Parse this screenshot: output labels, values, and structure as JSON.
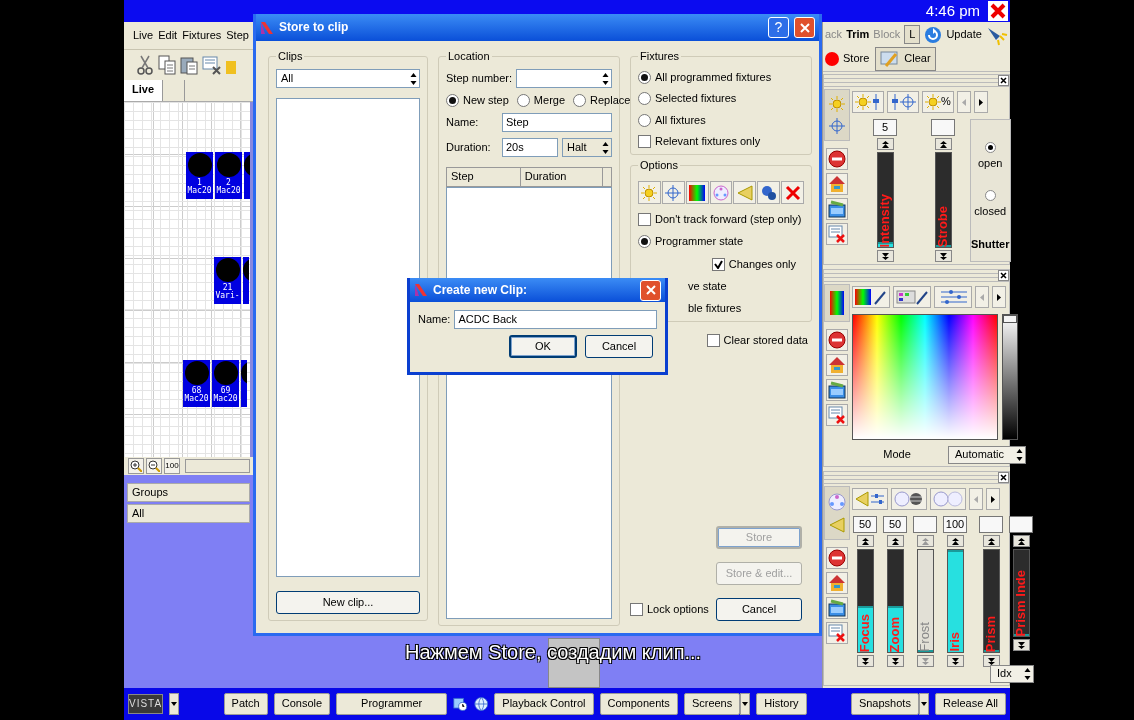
{
  "window": {
    "clock": "4:46 pm"
  },
  "menu": [
    "Live",
    "Edit",
    "Fixtures",
    "Step"
  ],
  "view_tabs": [
    {
      "label": "Live",
      "selected": true
    }
  ],
  "fixtures": [
    {
      "number": "1",
      "name": "Mac20"
    },
    {
      "number": "2",
      "name": "Mac20"
    },
    {
      "partial": true
    },
    {
      "number": "21",
      "name": "Vari-"
    },
    {
      "partial": true
    },
    {
      "number": "68",
      "name": "Mac20"
    },
    {
      "number": "69",
      "name": "Mac20"
    },
    {
      "partial": true
    }
  ],
  "zoom_label": "100",
  "groups_panel": {
    "header": "Groups",
    "items": [
      "All"
    ]
  },
  "right_toolbar": {
    "items": [
      {
        "label": "ack",
        "disabled": true
      },
      {
        "label": "Trim",
        "disabled": false
      },
      {
        "label": "Block",
        "disabled": true
      }
    ],
    "toggle": "L",
    "update": "Update"
  },
  "programmer_actions": [
    "Store",
    "Clear"
  ],
  "intensity_panel": {
    "tab_label": "%",
    "faders": [
      {
        "label": "Intensity",
        "value": "5",
        "level": 0.05,
        "disabled": false
      },
      {
        "label": "Strobe",
        "level": 0,
        "disabled": false
      }
    ],
    "shutter": {
      "label": "Shutter",
      "options": [
        {
          "label": "open",
          "selected": true
        },
        {
          "label": "closed",
          "selected": false
        }
      ]
    }
  },
  "color_panel": {
    "brightness": {
      "level": 1
    },
    "mode_label": "Mode",
    "mode": "Automatic"
  },
  "beam_panel": {
    "faders": [
      {
        "label": "Focus",
        "value": "50",
        "level": 0.45,
        "disabled": false
      },
      {
        "label": "Zoom",
        "value": "50",
        "level": 0.45,
        "disabled": false
      },
      {
        "label": "Frost",
        "level": 0,
        "disabled": true
      },
      {
        "label": "Iris",
        "value": "100",
        "level": 1,
        "disabled": false
      },
      {
        "label": "Prism",
        "level": 0,
        "disabled": false
      },
      {
        "label": "Prism Inde",
        "level": 0,
        "disabled": false
      }
    ],
    "index_mode": "Idx"
  },
  "store_dialog": {
    "title": "Store to clip",
    "help": "?",
    "clips": {
      "label": "Clips",
      "filter": "All",
      "new_button": "New clip..."
    },
    "location": {
      "label": "Location",
      "step_number_label": "Step number:",
      "modes": [
        {
          "label": "New step",
          "selected": true
        },
        {
          "label": "Merge",
          "selected": false
        },
        {
          "label": "Replace",
          "selected": false
        }
      ],
      "name_label": "Name:",
      "name": "Step",
      "duration_label": "Duration:",
      "duration": "20s",
      "duration_mode": "Halt",
      "columns": [
        "Step",
        "Duration"
      ]
    },
    "fixtures": {
      "label": "Fixtures",
      "options": [
        {
          "kind": "radio",
          "label": "All programmed fixtures",
          "selected": true
        },
        {
          "kind": "radio",
          "label": "Selected fixtures",
          "selected": false
        },
        {
          "kind": "radio",
          "label": "All fixtures",
          "selected": false
        },
        {
          "kind": "checkbox",
          "label": "Relevant fixtures only",
          "checked": false
        }
      ]
    },
    "options": {
      "label": "Options",
      "items": [
        {
          "kind": "checkbox",
          "label": "Don't track forward (step only)",
          "checked": false
        },
        {
          "kind": "radio",
          "label": "Programmer state",
          "selected": true
        },
        {
          "kind": "subcheckbox",
          "label": "Changes only",
          "checked": true
        },
        {
          "kind": "partial",
          "label": "ve state"
        },
        {
          "kind": "partial",
          "label": "ble fixtures"
        }
      ]
    },
    "clear_stored_data": {
      "label": "Clear stored data",
      "checked": false
    },
    "lock_options": {
      "label": "Lock options",
      "checked": false
    },
    "buttons": [
      {
        "label": "Store",
        "disabled": true,
        "default": true
      },
      {
        "label": "Store & edit...",
        "disabled": true,
        "default": false
      },
      {
        "label": "Cancel",
        "disabled": false,
        "default": false
      }
    ]
  },
  "clip_dialog": {
    "title": "Create new Clip:",
    "name_label": "Name:",
    "name": "ACDC Back",
    "buttons": [
      "OK",
      "Cancel"
    ]
  },
  "subtitle": "Нажмем Store, создадим клип...",
  "taskbar": {
    "logo": "VISTA",
    "buttons": [
      {
        "label": "Patch",
        "dropdown": false
      },
      {
        "label": "Console",
        "dropdown": false
      },
      {
        "label": "Programmer",
        "dropdown": false
      },
      {
        "label": "Playback Control",
        "dropdown": false
      },
      {
        "label": "Components",
        "dropdown": false
      },
      {
        "label": "Screens",
        "dropdown": true
      },
      {
        "label": "History",
        "dropdown": false
      },
      {
        "label": "Snapshots",
        "dropdown": true
      },
      {
        "label": "Release All",
        "dropdown": false
      }
    ]
  }
}
